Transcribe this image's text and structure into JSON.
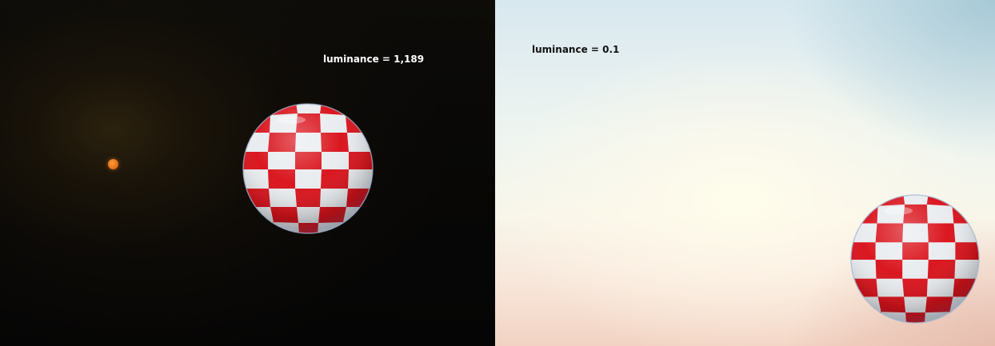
{
  "panels": {
    "left": {
      "label": "luminance = 1,189"
    },
    "right": {
      "label": "luminance = 0.1"
    }
  },
  "colors": {
    "ball_red": "#d9121b",
    "ball_white": "#e9ecef",
    "sun": "#e8741a",
    "left_background": "#060606",
    "right_sky_top": "#d7e8ef",
    "right_sky_bottom": "#f2d3c3"
  },
  "icons": {
    "ball": "checkered-ball-icon",
    "sun": "sun-icon"
  }
}
